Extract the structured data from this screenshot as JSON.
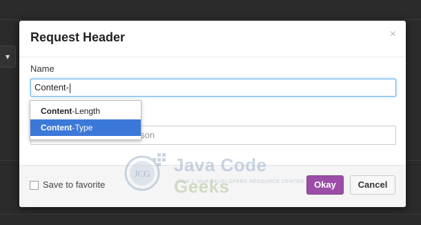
{
  "dialog": {
    "title": "Request Header",
    "close_glyph": "×",
    "name_label": "Name",
    "name_value": "Content-",
    "value_placeholder": "e.g. text/plain, application/json"
  },
  "autocomplete": {
    "items": [
      {
        "match": "Content",
        "rest": "-Length",
        "active": false
      },
      {
        "match": "Content",
        "rest": "-Type",
        "active": true
      }
    ]
  },
  "footer": {
    "favorite_label": "Save to favorite",
    "favorite_checked": false,
    "ok_label": "Okay",
    "cancel_label": "Cancel"
  },
  "watermark": {
    "logo_text": "JCG",
    "title_part1": "Java ",
    "title_part2": "Code ",
    "title_part3": "Geeks",
    "subtitle": "JAVA 2 JAVA DEVELOPERS RESOURCE CENTER"
  },
  "background": {
    "chevron_glyph": "▾"
  },
  "colors": {
    "ok_button": "#9b4da8",
    "dropdown_active": "#3c78d8",
    "input_focus": "#66afe9"
  }
}
